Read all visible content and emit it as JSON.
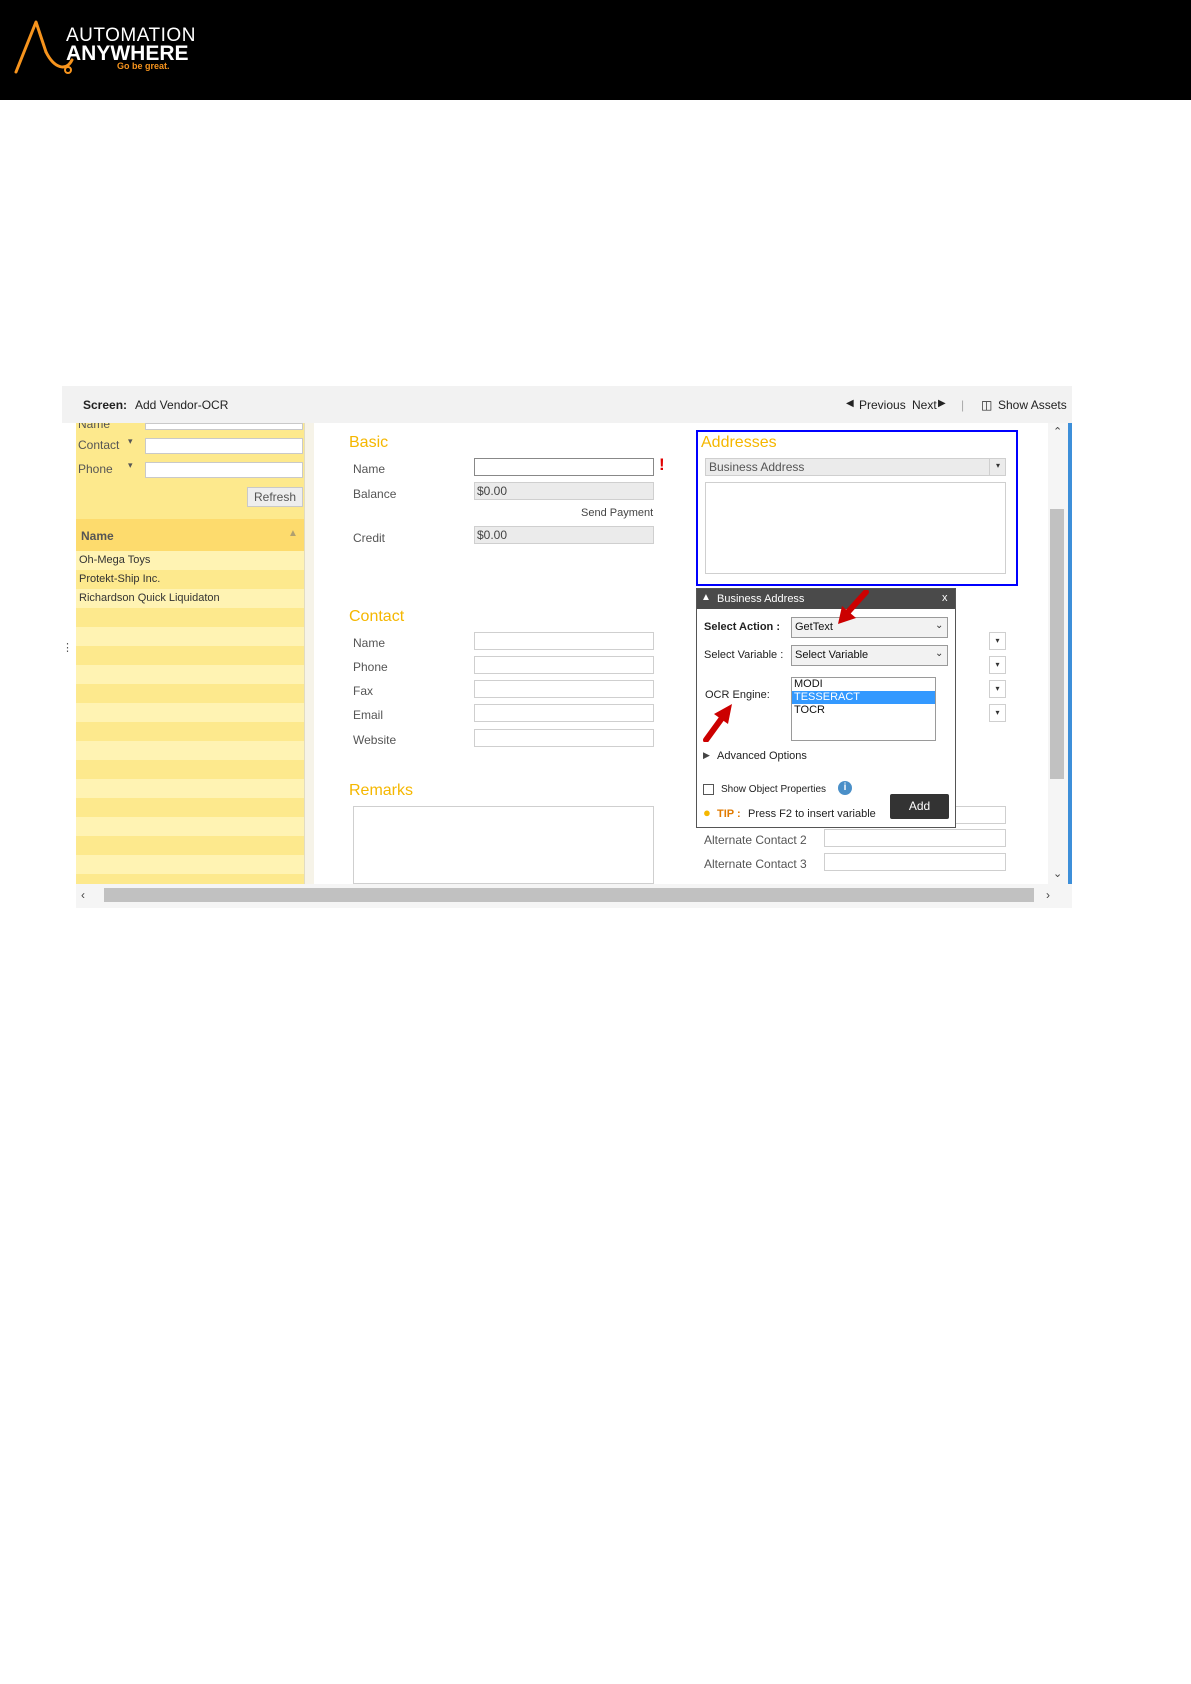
{
  "brand": {
    "line1": "AUTOMATION",
    "line2": "ANYWHERE",
    "tagline": "Go be great."
  },
  "topbar": {
    "screen_label": "Screen:",
    "screen_name": "Add Vendor-OCR",
    "previous": "Previous",
    "next": "Next",
    "show_assets": "Show Assets"
  },
  "left_panel": {
    "field_cut": "Name",
    "contact_label": "Contact",
    "phone_label": "Phone",
    "refresh": "Refresh",
    "column_header": "Name",
    "rows": [
      "Oh-Mega Toys",
      "Protekt-Ship Inc.",
      "Richardson Quick Liquidaton"
    ]
  },
  "basic": {
    "title": "Basic",
    "name": "Name",
    "balance": "Balance",
    "balance_value": "$0.00",
    "send_payment": "Send Payment",
    "credit": "Credit",
    "credit_value": "$0.00"
  },
  "contact": {
    "title": "Contact",
    "name": "Name",
    "phone": "Phone",
    "fax": "Fax",
    "email": "Email",
    "website": "Website"
  },
  "remarks": {
    "title": "Remarks"
  },
  "addresses": {
    "title": "Addresses",
    "dropdown": "Business Address",
    "alt_contact_2": "Alternate Contact 2",
    "alt_contact_3": "Alternate Contact 3"
  },
  "dialog": {
    "title": "Business Address",
    "close": "x",
    "select_action_label": "Select Action :",
    "select_action_value": "GetText",
    "select_variable_label": "Select Variable :",
    "select_variable_value": "Select Variable",
    "ocr_engine_label": "OCR Engine:",
    "ocr_options": [
      "MODI",
      "TESSERACT",
      "TOCR"
    ],
    "ocr_selected": "TESSERACT",
    "advanced_options": "Advanced Options",
    "show_object_properties": "Show Object Properties",
    "tip_label": "TIP :",
    "tip_text": "Press F2 to insert variable",
    "add": "Add"
  },
  "colors": {
    "accent_yellow": "#f5b700",
    "panel_yellow": "#fde98d",
    "highlight_blue": "#0000ff",
    "arrow_red": "#cc0000",
    "selection_blue": "#3399ff",
    "brand_orange": "#f7941d"
  }
}
